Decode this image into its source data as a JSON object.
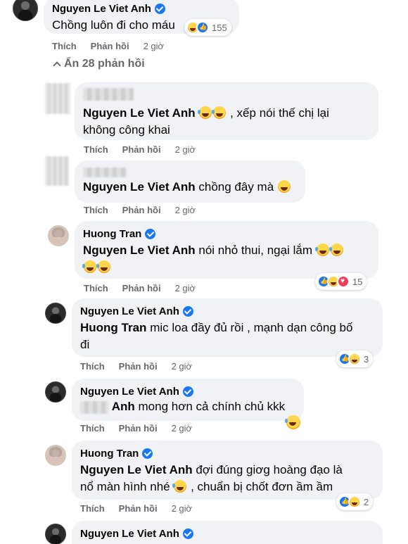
{
  "root": {
    "author": "Nguyen Le Viet Anh",
    "text": "Chồng luôn đi cho máu",
    "reaction_count": "155",
    "actions": {
      "like": "Thích",
      "reply": "Phản hồi",
      "time": "2 giờ"
    }
  },
  "hide_replies": "Ẩn 28 phản hồi",
  "replies": [
    {
      "author": "",
      "tag": "Nguyen Le Viet Anh",
      "text_a": ", xếp nói thế chị lại",
      "text_b": "không công khai",
      "reaction_count": ""
    },
    {
      "author": "",
      "tag": "Nguyen Le Viet Anh",
      "text_a": "chồng đây mà",
      "reaction_count": ""
    },
    {
      "author": "Huong Tran",
      "tag": "Nguyen Le Viet Anh",
      "text_a": "nói nhỏ thui, ngại lắm",
      "reaction_count": "15"
    },
    {
      "author": "Nguyen Le Viet Anh",
      "tag": "Huong Tran",
      "text_a": "mic loa đầy đủ rồi , mạnh dạn công bố",
      "text_b": "đi",
      "reaction_count": "3"
    },
    {
      "author": "Nguyen Le Viet Anh",
      "tag": "Anh",
      "text_a": "mong hơn cả chính chủ kkk",
      "reaction_count": ""
    },
    {
      "author": "Huong Tran",
      "tag": "Nguyen Le Viet Anh",
      "text_a": "đợi đúng giơg hoàng đạo là",
      "text_b": "nổ màn hình nhé",
      "text_c": ", chuẩn bị chốt đơn ầm ầm",
      "reaction_count": "2"
    },
    {
      "author": "Nguyen Le Viet Anh"
    }
  ],
  "actions": {
    "like": "Thích",
    "reply": "Phản hồi",
    "time": "2 giờ"
  },
  "colors": {
    "bubble": "#f0f2f5",
    "verified": "#1877f2",
    "meta": "#65676b"
  }
}
